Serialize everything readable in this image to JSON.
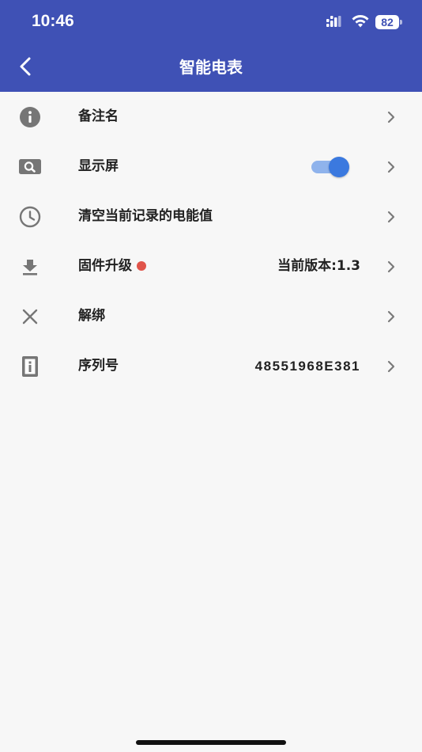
{
  "status_bar": {
    "time": "10:46",
    "battery": "82"
  },
  "nav": {
    "title": "智能电表",
    "back_icon": "chevron-left-icon"
  },
  "colors": {
    "header": "#3f51b5",
    "toggle_on": "#3b79df",
    "badge": "#e0544a"
  },
  "rows": [
    {
      "label": "备注名",
      "icon": "info-icon"
    },
    {
      "label": "显示屏",
      "icon": "screen-search-icon",
      "toggle_on": true
    },
    {
      "label": "清空当前记录的电能值",
      "icon": "clock-icon"
    },
    {
      "label": "固件升级",
      "icon": "download-icon",
      "has_badge": true,
      "value": "当前版本:1.3"
    },
    {
      "label": "解绑",
      "icon": "close-icon"
    },
    {
      "label": "序列号",
      "icon": "serial-info-icon",
      "value": "48551968E381"
    }
  ]
}
